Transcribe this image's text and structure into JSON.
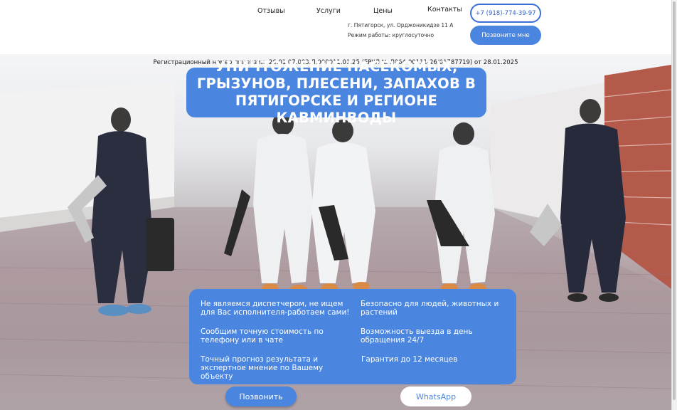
{
  "nav": {
    "reviews": "Отзывы",
    "services": "Услуги",
    "prices": "Цены",
    "contacts": "Контакты"
  },
  "header": {
    "address": "г. Пятигорск, ул. Орджоникидзе 11 А",
    "hours": "Режим работы: круглосуточно",
    "phone": "+7 (918)-774-39-97",
    "call_me": "Позвоните мне"
  },
  "hero": {
    "license": "Регистрационный номер лицензии: 26.01.07.003.Л.000011.01.25 (ЕРУЛ № Л064-00111-26/01787719) от 28.01.2025",
    "title": "УНИЧТОЖЕНИЕ НАСЕКОМЫХ, ГРЫЗУНОВ, ПЛЕСЕНИ, ЗАПАХОВ В ПЯТИГОРСКЕ И РЕГИОНЕ КАВМИНВОДЫ",
    "features": [
      "Не являемся диспетчером, не ищем для Вас исполнителя-работаем сами!",
      "Безопасно для людей, животных и растений",
      "Сообщим точную стоимость по телефону или в чате",
      "Возможность выезда в день обращения 24/7",
      "Точный прогноз результата и экспертное мнение по Вашему объекту",
      "Гарантия до 12 месяцев"
    ],
    "call_button": "Позвонить",
    "whatsapp_button": "WhatsApp"
  },
  "colors": {
    "accent": "#4a85e0",
    "accent_dark": "#3b6fd6"
  }
}
